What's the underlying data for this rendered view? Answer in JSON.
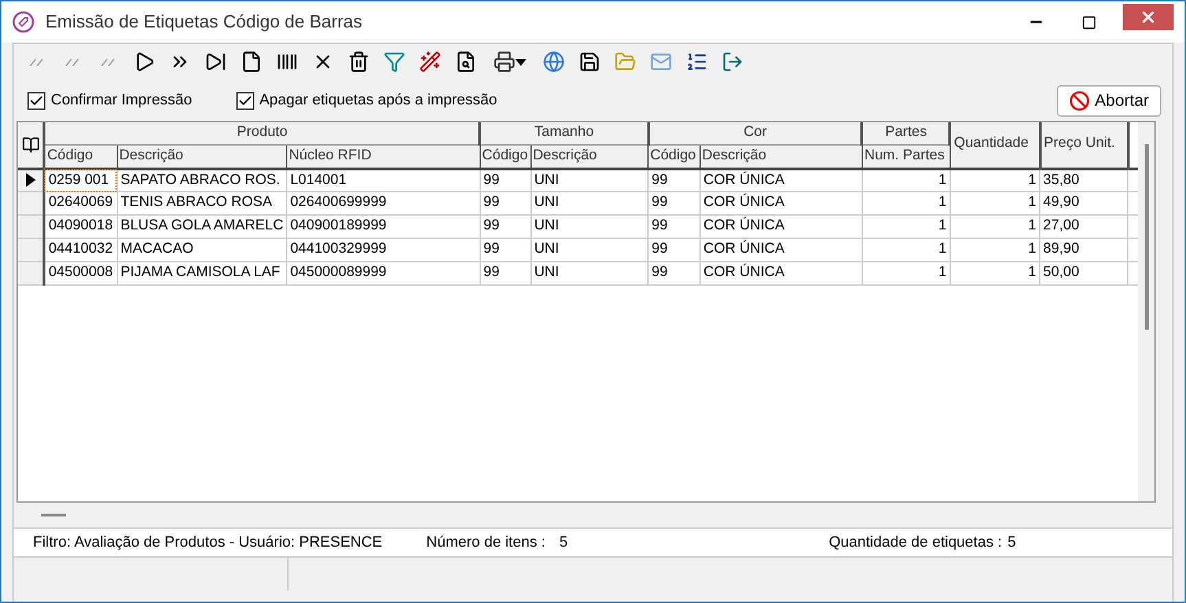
{
  "window": {
    "title": "Emissão de Etiquetas Código de Barras"
  },
  "toolbar": [
    {
      "disabled": true
    },
    {
      "disabled": true
    },
    {
      "disabled": true
    },
    {
      "disabled": false
    },
    {
      "disabled": false
    },
    {
      "disabled": false
    },
    {
      "disabled": false
    },
    {
      "disabled": false
    },
    {
      "disabled": false
    },
    {
      "disabled": false
    },
    {
      "disabled": false
    },
    {
      "disabled": false
    },
    {
      "disabled": false
    },
    {
      "disabled": false
    },
    {
      "disabled": false
    },
    {
      "disabled": false
    },
    {
      "disabled": false
    },
    {
      "disabled": false
    },
    {
      "disabled": false
    },
    {
      "disabled": false
    }
  ],
  "options": [
    {
      "label": "Confirmar Impressão",
      "checked": true
    },
    {
      "label": "Apagar etiquetas após a impressão",
      "checked": true
    }
  ],
  "abort_button": {
    "label": "Abortar"
  },
  "table": {
    "groups": [
      {
        "label": "Produto"
      },
      {
        "label": "Tamanho"
      },
      {
        "label": "Cor"
      },
      {
        "label": "Partes"
      }
    ],
    "columns": [
      "Código",
      "Descrição",
      "Núcleo RFID",
      "Código",
      "Descrição",
      "Código",
      "Descrição",
      "Num. Partes",
      "Quantidade",
      "Preço Unit."
    ],
    "rows": [
      {
        "selected": true,
        "cells": [
          "0259 001",
          "SAPATO ABRACO ROS.",
          "L014001",
          "99",
          "UNI",
          "99",
          "COR ÚNICA",
          "1",
          "1",
          "35,80"
        ]
      },
      {
        "selected": false,
        "cells": [
          "02640069",
          "TENIS ABRACO ROSA",
          "026400699999",
          "99",
          "UNI",
          "99",
          "COR ÚNICA",
          "1",
          "1",
          "49,90"
        ]
      },
      {
        "selected": false,
        "cells": [
          "04090018",
          "BLUSA GOLA AMARELC",
          "040900189999",
          "99",
          "UNI",
          "99",
          "COR ÚNICA",
          "1",
          "1",
          "27,00"
        ]
      },
      {
        "selected": false,
        "cells": [
          "04410032",
          "MACACAO",
          "044100329999",
          "99",
          "UNI",
          "99",
          "COR ÚNICA",
          "1",
          "1",
          "89,90"
        ]
      },
      {
        "selected": false,
        "cells": [
          "04500008",
          "PIJAMA CAMISOLA LAF",
          "045000089999",
          "99",
          "UNI",
          "99",
          "COR ÚNICA",
          "1",
          "1",
          "50,00"
        ]
      }
    ]
  },
  "summary": {
    "filter": "Filtro: Avaliação de Produtos - Usuário: PRESENCE",
    "items_label": "Número de itens :",
    "items_value": "5",
    "labels_label": "Quantidade de etiquetas :",
    "labels_value": "5"
  }
}
